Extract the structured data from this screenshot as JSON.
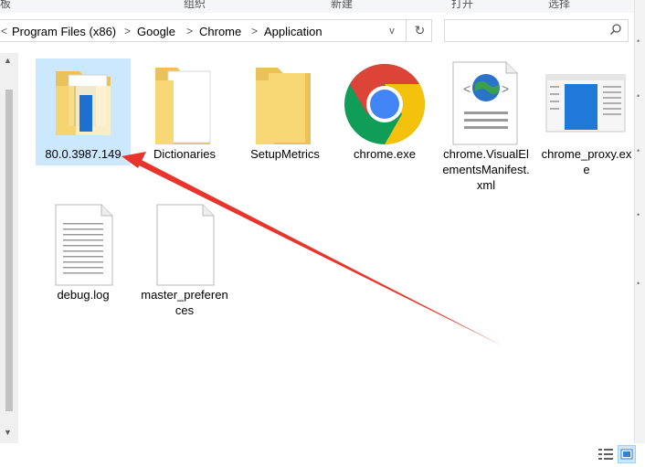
{
  "ribbon": {
    "tabs": [
      "板",
      "组织",
      "新建",
      "打开",
      "选择"
    ]
  },
  "address_bar": {
    "back_glyph": "<",
    "crumbs": [
      "Program Files (x86)",
      "Google",
      "Chrome",
      "Application"
    ],
    "separator": ">",
    "dropdown_glyph": "v",
    "refresh_glyph": "↻"
  },
  "search": {
    "placeholder": ""
  },
  "files": [
    {
      "name": "80.0.3987.149",
      "icon": "folder-with-document-icon",
      "selected": true
    },
    {
      "name": "Dictionaries",
      "icon": "folder-with-paper-icon",
      "selected": false
    },
    {
      "name": "SetupMetrics",
      "icon": "folder-icon",
      "selected": false
    },
    {
      "name": "chrome.exe",
      "icon": "chrome-logo-icon",
      "selected": false
    },
    {
      "name": "chrome.VisualElementsManifest.xml",
      "icon": "xml-file-icon",
      "selected": false
    },
    {
      "name": "chrome_proxy.exe",
      "icon": "application-window-icon",
      "selected": false
    },
    {
      "name": "debug.log",
      "icon": "text-file-icon",
      "selected": false
    },
    {
      "name": "master_preferences",
      "icon": "blank-file-icon",
      "selected": false
    }
  ],
  "colors": {
    "selection": "#cce8ff",
    "folder": "#f8d775",
    "arrow": "#e8342a",
    "chrome_red": "#db4437",
    "chrome_yellow": "#f4c20d",
    "chrome_green": "#0f9d58",
    "chrome_blue": "#4285f4"
  }
}
